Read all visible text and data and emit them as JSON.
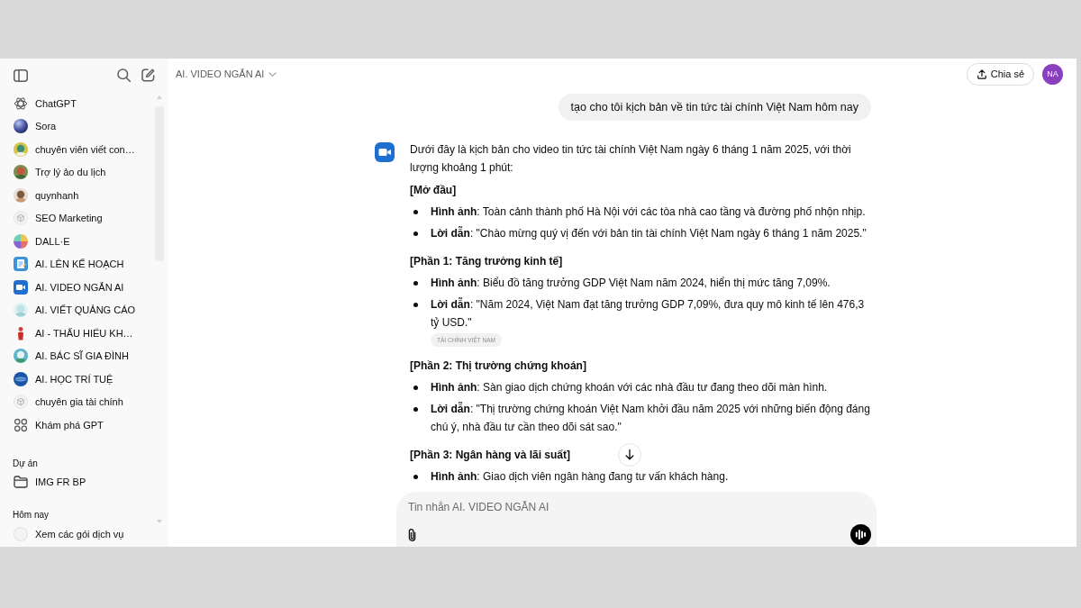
{
  "sidebar": {
    "gpts": [
      {
        "label": "ChatGPT"
      },
      {
        "label": "Sora"
      },
      {
        "label": "chuyên viên viết con…"
      },
      {
        "label": "Trợ lý ảo du lịch"
      },
      {
        "label": "quynhanh"
      },
      {
        "label": "SEO Marketing"
      },
      {
        "label": "DALL·E"
      },
      {
        "label": "AI. LÊN KẾ HOẠCH"
      },
      {
        "label": "AI. VIDEO NGẮN AI"
      },
      {
        "label": "AI. VIẾT QUẢNG CÁO"
      },
      {
        "label": "AI - THẤU HIỂU KH…"
      },
      {
        "label": "AI. BÁC SĨ GIA ĐÌNH"
      },
      {
        "label": "AI. HỌC TRÍ TUỆ"
      },
      {
        "label": "chuyên gia tài chính"
      }
    ],
    "explore": "Khám phá GPT",
    "projects": {
      "heading": "Dự án",
      "items": [
        "IMG FR BP"
      ]
    },
    "history": {
      "heading": "Hôm nay",
      "items": [
        "Xem các gói dịch vụ"
      ]
    }
  },
  "header": {
    "title": "AI. VIDEO NGẮN AI",
    "share": "Chia sẻ",
    "avatar": "NA"
  },
  "conversation": {
    "user_message": {
      "text": "tạo cho tôi kịch bản về tin tức tài chính Việt Nam hôm nay"
    },
    "assistant_message": {
      "blocks": [
        {
          "kind": "paragraph",
          "text": "Dưới đây là kịch bản cho video tin tức tài chính Việt Nam ngày 6 tháng 1 năm 2025, với thời lượng khoảng 1 phút:"
        },
        {
          "kind": "heading",
          "text": "[Mở đầu]"
        },
        {
          "kind": "bullet",
          "text": "**Hình ảnh**: Toàn cảnh thành phố Hà Nội với các tòa nhà cao tầng và đường phố nhộn nhịp."
        },
        {
          "kind": "bullet",
          "text": "**Lời dẫn**: \"Chào mừng quý vị đến với bản tin tài chính Việt Nam ngày 6 tháng 1 năm 2025.\""
        },
        {
          "kind": "heading",
          "text": "[Phần 1: Tăng trưởng kinh tế]"
        },
        {
          "kind": "bullet",
          "text": "**Hình ảnh**: Biểu đồ tăng trưởng GDP Việt Nam năm 2024, hiển thị mức tăng 7,09%."
        },
        {
          "kind": "bullet",
          "text": "**Lời dẫn**: \"Năm 2024, Việt Nam đạt tăng trưởng GDP 7,09%, đưa quy mô kinh tế lên 476,3 tỷ USD.\"",
          "citation": "TÀI CHÍNH VIỆT NAM"
        },
        {
          "kind": "heading",
          "text": "[Phần 2: Thị trường chứng khoán]"
        },
        {
          "kind": "bullet",
          "text": "**Hình ảnh**: Sàn giao dịch chứng khoán với các nhà đầu tư đang theo dõi màn hình."
        },
        {
          "kind": "bullet",
          "text": "**Lời dẫn**: \"Thị trường chứng khoán Việt Nam khởi đầu năm 2025 với những biến động đáng chú ý, nhà đầu tư cần theo dõi sát sao.\""
        },
        {
          "kind": "heading",
          "text": "[Phần 3: Ngân hàng và lãi suất]"
        },
        {
          "kind": "bullet",
          "text": "**Hình ảnh**: Giao dịch viên ngân hàng đang tư vấn khách hàng."
        }
      ]
    }
  },
  "composer": {
    "placeholder": "Tin nhắn AI. VIDEO NGẮN AI"
  }
}
